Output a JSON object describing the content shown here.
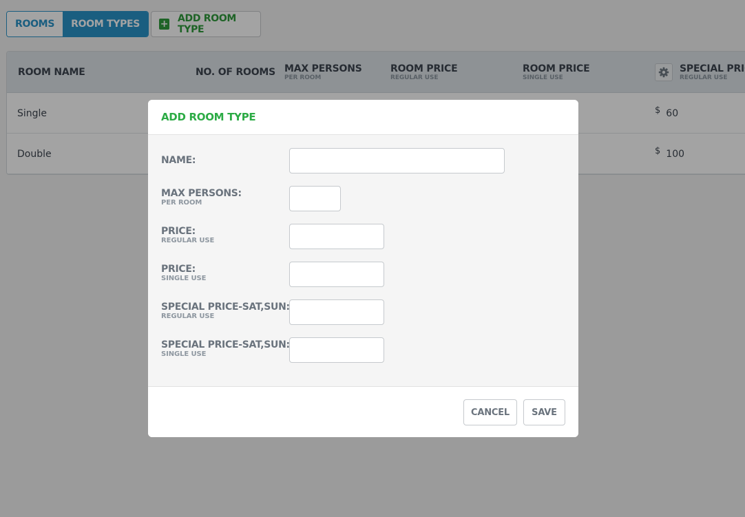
{
  "toolbar": {
    "tabs": [
      {
        "label": "ROOMS",
        "active": false
      },
      {
        "label": "ROOM TYPES",
        "active": true
      }
    ],
    "add_button_label": "ADD ROOM TYPE"
  },
  "table": {
    "columns": [
      {
        "label": "ROOM NAME",
        "sub": ""
      },
      {
        "label": "NO. OF ROOMS",
        "sub": ""
      },
      {
        "label": "MAX PERSONS",
        "sub": "PER ROOM"
      },
      {
        "label": "ROOM PRICE",
        "sub": "REGULAR USE"
      },
      {
        "label": "ROOM PRICE",
        "sub": "SINGLE USE"
      },
      {
        "label": "SPECIAL PRICE",
        "sub": "REGULAR USE"
      }
    ],
    "rows": [
      {
        "name": "Single",
        "currency": "$",
        "special_price": "60"
      },
      {
        "name": "Double",
        "currency": "$",
        "special_price": "100"
      }
    ]
  },
  "modal": {
    "title": "ADD ROOM TYPE",
    "fields": [
      {
        "label": "NAME:",
        "sub": "",
        "value": ""
      },
      {
        "label": "MAX PERSONS:",
        "sub": "PER ROOM",
        "value": ""
      },
      {
        "label": "PRICE:",
        "sub": "REGULAR USE",
        "value": ""
      },
      {
        "label": "PRICE:",
        "sub": "SINGLE USE",
        "value": ""
      },
      {
        "label": "SPECIAL PRICE-SAT,SUN:",
        "sub": "REGULAR USE",
        "value": ""
      },
      {
        "label": "SPECIAL PRICE-SAT,SUN:",
        "sub": "SINGLE USE",
        "value": ""
      }
    ],
    "cancel_label": "CANCEL",
    "save_label": "SAVE"
  },
  "colors": {
    "accent_blue": "#2a93c9",
    "accent_green": "#2cab45",
    "overlay": "rgba(0,0,0,0.36)"
  }
}
